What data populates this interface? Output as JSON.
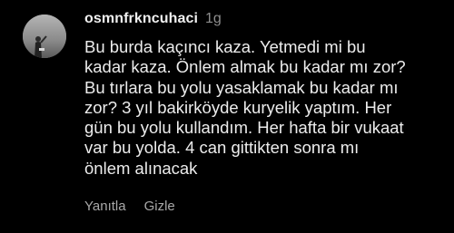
{
  "comment": {
    "username": "osmnfrkncuhaci",
    "timestamp": "1g",
    "avatar_icon": "profile-photo",
    "body_lines": [
      "Bu burda kaçıncı kaza. Yetmedi mi bu",
      "kadar kaza. Önlem almak bu kadar mı zor?",
      "Bu tırlara bu yolu yasaklamak bu kadar mı",
      "zor? 3 yıl bakirköyde kuryelik yaptım. Her",
      "gün bu yolu kullandım. Her hafta bir vukaat",
      "var bu yolda. 4 can gittikten sonra mı",
      "önlem alınacak"
    ],
    "actions": {
      "reply_label": "Yanıtla",
      "hide_label": "Gizle"
    }
  },
  "colors": {
    "background": "#000000",
    "username": "#f0f0f0",
    "muted": "#8e8e8e",
    "body": "#ececec"
  }
}
